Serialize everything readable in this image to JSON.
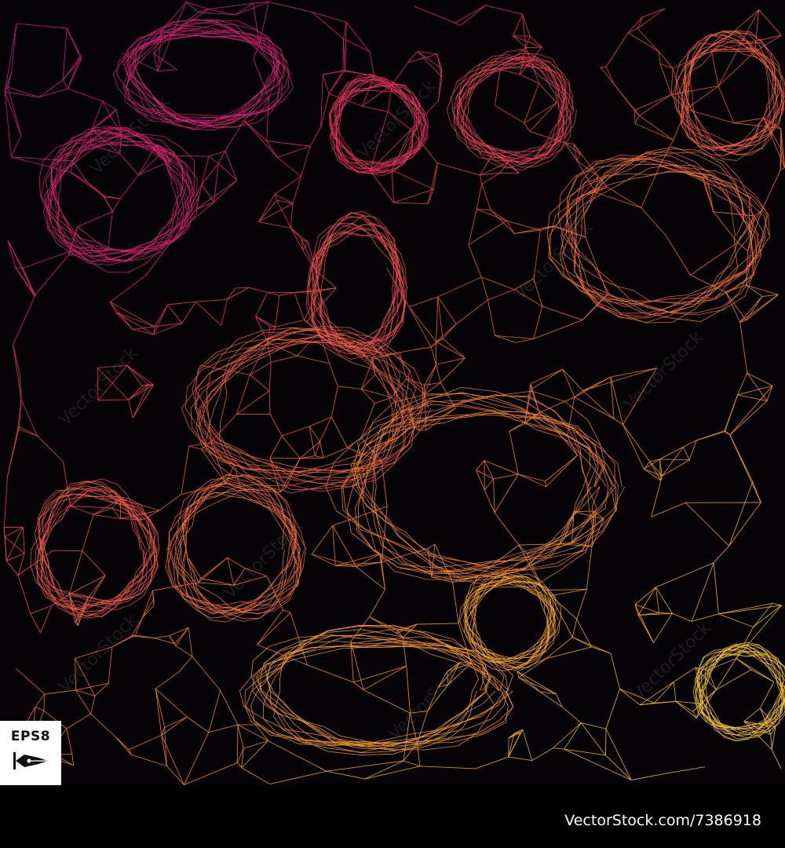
{
  "artwork": {
    "palette": [
      "#c2188f",
      "#e8256f",
      "#f26a3a",
      "#f6a52c",
      "#f3d13a"
    ],
    "background": "#050305",
    "watermark_text": "VectorStock"
  },
  "badge": {
    "label": "EPS8",
    "icon": "pen-nib-icon"
  },
  "footer": {
    "text": "VectorStock.com/7386918"
  }
}
